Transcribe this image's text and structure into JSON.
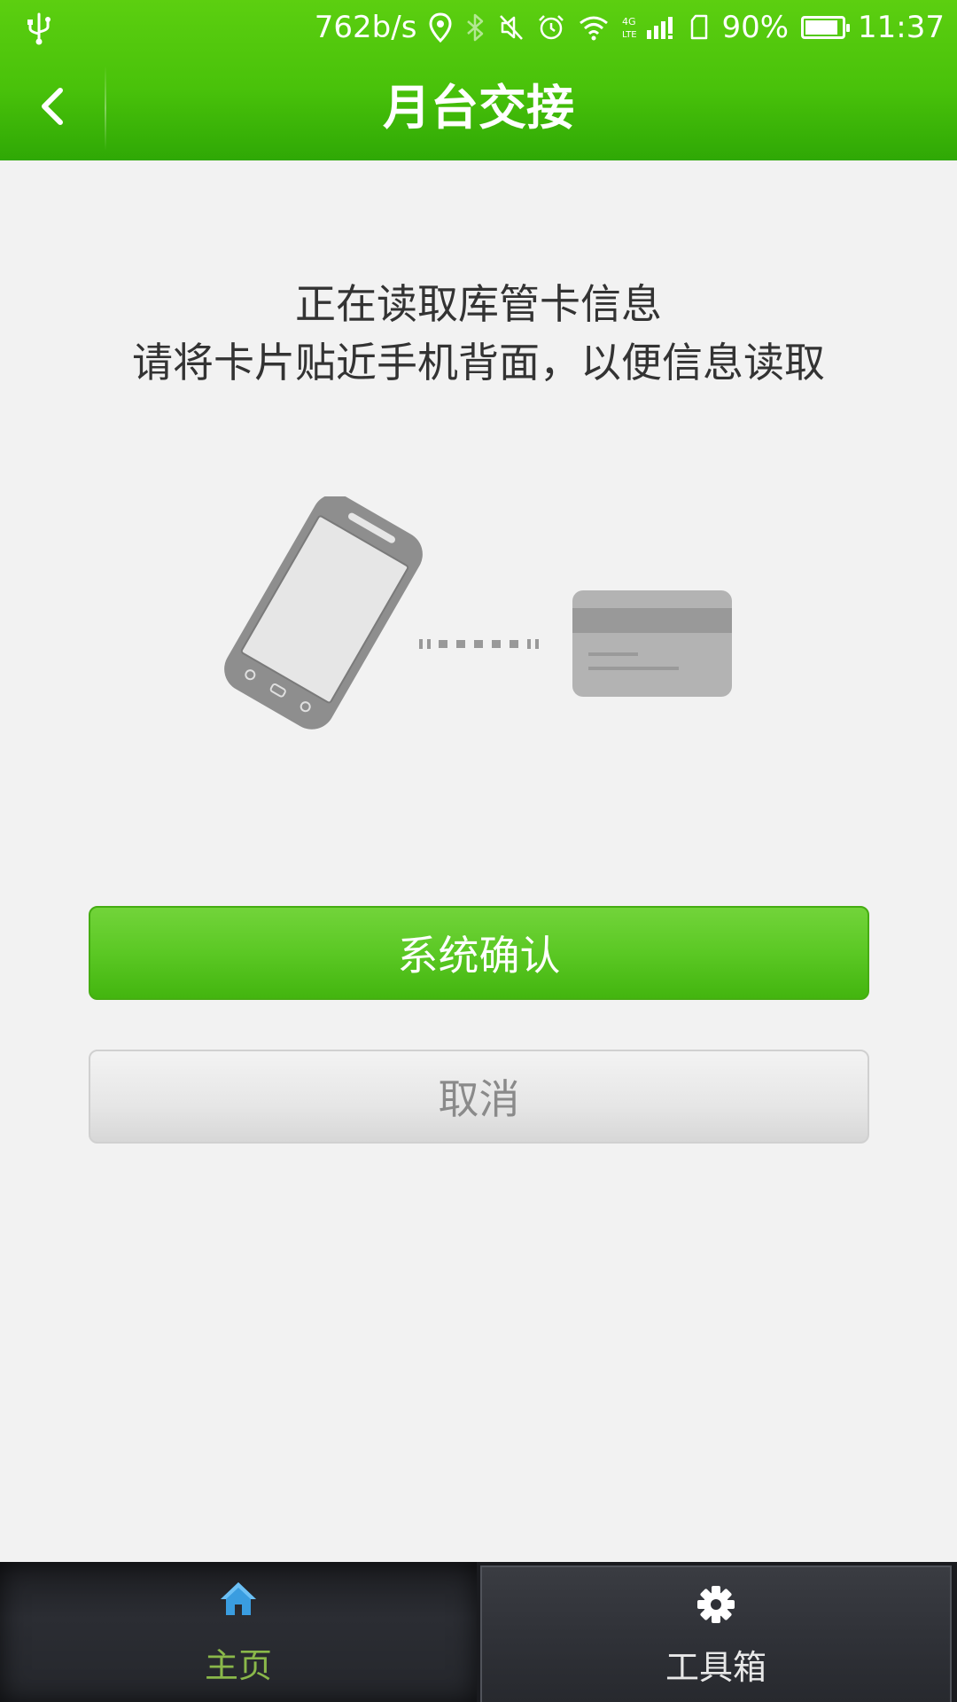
{
  "status_bar": {
    "network_speed": "762b/s",
    "network_type_label": "4G LTE",
    "battery_percent": "90%",
    "battery_level": 0.9,
    "time": "11:37",
    "icons": [
      "usb-icon",
      "location-icon",
      "bluetooth-icon",
      "mute-icon",
      "alarm-icon",
      "wifi-icon",
      "signal-icon",
      "sim-icon",
      "battery-icon"
    ]
  },
  "header": {
    "back_icon": "chevron-left-icon",
    "title": "月台交接"
  },
  "main": {
    "instruction_line1": "正在读取库管卡信息",
    "instruction_line2": "请将卡片贴近手机背面，以便信息读取",
    "illustration": [
      "phone-icon",
      "dotted-connector",
      "card-icon"
    ],
    "confirm_label": "系统确认",
    "cancel_label": "取消"
  },
  "bottom_nav": {
    "tabs": [
      {
        "label": "主页",
        "icon": "home-icon",
        "active": true
      },
      {
        "label": "工具箱",
        "icon": "gear-icon",
        "active": false
      }
    ]
  },
  "colors": {
    "brand_green": "#49c20a",
    "confirm_green": "#5bc824",
    "nav_active_text": "#8ab84a",
    "home_icon_blue": "#3a9de0"
  }
}
